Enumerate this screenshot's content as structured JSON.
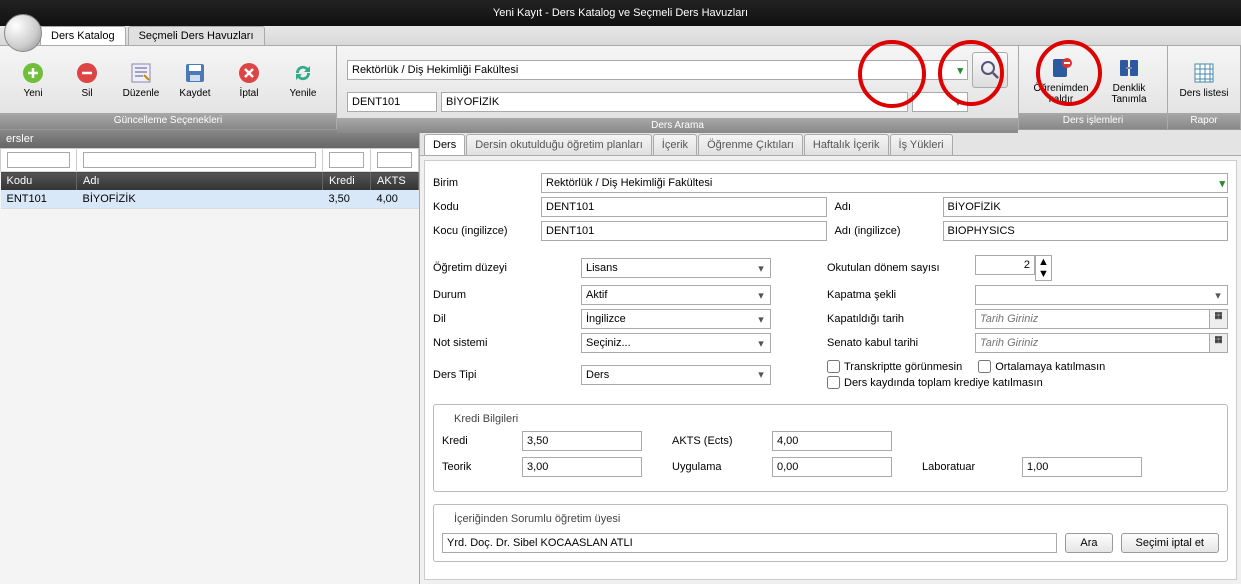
{
  "window": {
    "title": "Yeni Kayıt - Ders Katalog ve Seçmeli Ders Havuzları"
  },
  "mainTabs": {
    "t1": "Ders Katalog",
    "t2": "Seçmeli Ders Havuzları"
  },
  "ribbon": {
    "yeni": "Yeni",
    "sil": "Sil",
    "duzenle": "Düzenle",
    "kaydet": "Kaydet",
    "iptal": "İptal",
    "yenile": "Yenile",
    "group1": "Güncelleme Seçenekleri",
    "search_unit": "Rektörlük / Diş Hekimliği Fakültesi",
    "search_code": "DENT101",
    "search_name": "BİYOFİZİK",
    "group2": "Ders Arama",
    "ogrenimden": "Öğrenimden kaldır",
    "denklik": "Denklik Tanımla",
    "group3": "Ders işlemleri",
    "derslistesi": "Ders listesi",
    "group4": "Rapor"
  },
  "leftpanel": {
    "caption": "ersler",
    "cols": {
      "kodu": "Kodu",
      "adi": "Adı",
      "kredi": "Kredi",
      "akts": "AKTS"
    },
    "row": {
      "kodu": "ENT101",
      "adi": "BİYOFİZİK",
      "kredi": "3,50",
      "akts": "4,00"
    }
  },
  "subtabs": {
    "t1": "Ders",
    "t2": "Dersin okutulduğu öğretim planları",
    "t3": "İçerik",
    "t4": "Öğrenme Çıktıları",
    "t5": "Haftalık İçerik",
    "t6": "İş Yükleri"
  },
  "form": {
    "birim_lbl": "Birim",
    "birim_val": "Rektörlük / Diş Hekimliği Fakültesi",
    "kodu_lbl": "Kodu",
    "kodu_val": "DENT101",
    "adi_lbl": "Adı",
    "adi_val": "BİYOFİZİK",
    "kodu_en_lbl": "Kocu (ingilizce)",
    "kodu_en_val": "DENT101",
    "adi_en_lbl": "Adı (ingilizce)",
    "adi_en_val": "BIOPHYSICS",
    "ogretim_lbl": "Öğretim düzeyi",
    "ogretim_val": "Lisans",
    "okutulan_lbl": "Okutulan dönem sayısı",
    "okutulan_val": "2",
    "durum_lbl": "Durum",
    "durum_val": "Aktif",
    "kapatma_lbl": "Kapatma şekli",
    "dil_lbl": "Dil",
    "dil_val": "İngilizce",
    "kapatildigi_lbl": "Kapatıldığı tarih",
    "tarih_ph": "Tarih Giriniz",
    "notsistem_lbl": "Not sistemi",
    "notsistem_val": "Seçiniz...",
    "senato_lbl": "Senato kabul tarihi",
    "derstipi_lbl": "Ders Tipi",
    "derstipi_val": "Ders",
    "chk1": "Transkriptte görünmesin",
    "chk2": "Ortalamaya katılmasın",
    "chk3": "Ders kaydında toplam krediye katılmasın"
  },
  "kredi": {
    "title": "Kredi Bilgileri",
    "kredi_lbl": "Kredi",
    "kredi_val": "3,50",
    "akts_lbl": "AKTS (Ects)",
    "akts_val": "4,00",
    "teorik_lbl": "Teorik",
    "teorik_val": "3,00",
    "uygulama_lbl": "Uygulama",
    "uygulama_val": "0,00",
    "lab_lbl": "Laboratuar",
    "lab_val": "1,00"
  },
  "sorumlu": {
    "title": "İçeriğinden Sorumlu öğretim üyesi",
    "val": "Yrd. Doç. Dr. Sibel KOCAASLAN ATLI",
    "ara": "Ara",
    "iptal": "Seçimi iptal et"
  }
}
